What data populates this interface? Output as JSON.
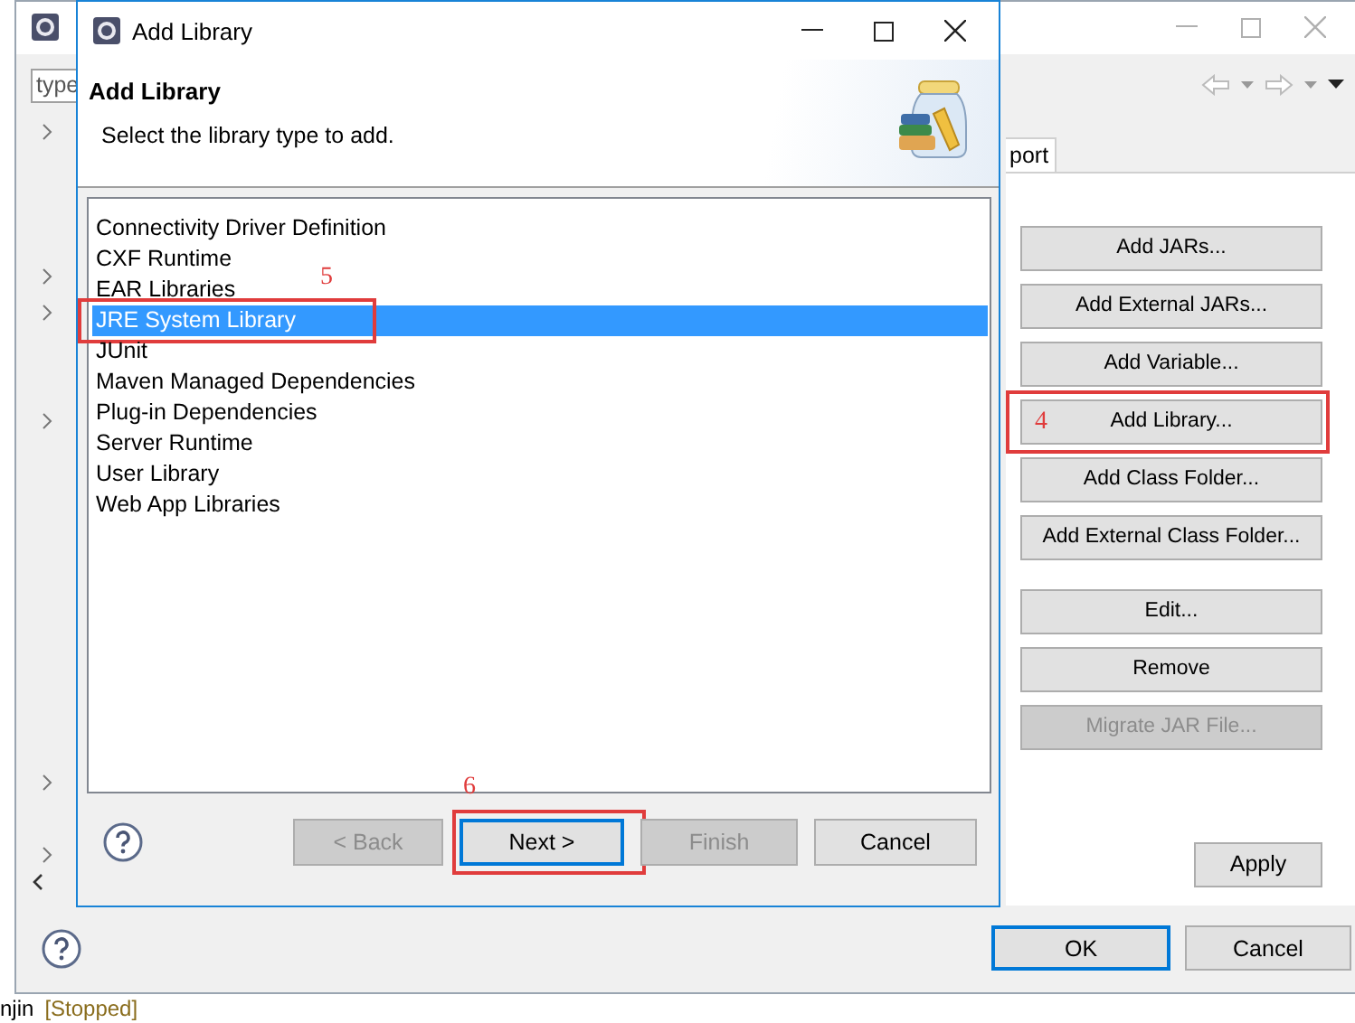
{
  "back_window": {
    "filter": {
      "value": "type"
    },
    "tree_rows": [
      {
        "expandable": true
      },
      {
        "expandable": false
      },
      {
        "expandable": false
      },
      {
        "expandable": false
      },
      {
        "expandable": true
      },
      {
        "expandable": true
      },
      {
        "expandable": false
      },
      {
        "expandable": false
      },
      {
        "expandable": true
      },
      {
        "expandable": false
      },
      {
        "expandable": false
      },
      {
        "expandable": false
      },
      {
        "expandable": false
      },
      {
        "expandable": false
      },
      {
        "expandable": false
      },
      {
        "expandable": false
      },
      {
        "expandable": false
      },
      {
        "expandable": false
      },
      {
        "expandable": true
      },
      {
        "expandable": false
      },
      {
        "expandable": true
      }
    ],
    "tab": {
      "label": "port"
    },
    "side_button_groups": [
      {
        "buttons": [
          {
            "label": "Add JARs...",
            "disabled": false
          },
          {
            "label": "Add External JARs...",
            "disabled": false
          },
          {
            "label": "Add Variable...",
            "disabled": false
          },
          {
            "label": "Add Library...",
            "disabled": false,
            "annotation": "4"
          },
          {
            "label": "Add Class Folder...",
            "disabled": false
          },
          {
            "label": "Add External Class Folder...",
            "disabled": false
          }
        ]
      },
      {
        "buttons": [
          {
            "label": "Edit...",
            "disabled": false
          },
          {
            "label": "Remove",
            "disabled": false
          },
          {
            "label": "Migrate JAR File...",
            "disabled": true
          }
        ]
      }
    ],
    "apply": "Apply",
    "footer_buttons": [
      {
        "label": "OK",
        "default": true
      },
      {
        "label": "Cancel",
        "default": false
      }
    ],
    "console": {
      "name": "njin",
      "state": "[Stopped]"
    }
  },
  "dialog": {
    "title": "Add Library",
    "heading": "Add Library",
    "description": "Select the library type to add.",
    "libraries": [
      {
        "label": "Connectivity Driver Definition",
        "selected": false
      },
      {
        "label": "CXF Runtime",
        "selected": false
      },
      {
        "label": "EAR Libraries",
        "selected": false
      },
      {
        "label": "JRE System Library",
        "selected": true,
        "annotation": "5"
      },
      {
        "label": "JUnit",
        "selected": false
      },
      {
        "label": "Maven Managed Dependencies",
        "selected": false
      },
      {
        "label": "Plug-in Dependencies",
        "selected": false
      },
      {
        "label": "Server Runtime",
        "selected": false
      },
      {
        "label": "User Library",
        "selected": false
      },
      {
        "label": "Web App Libraries",
        "selected": false
      }
    ],
    "buttons": [
      {
        "label": "< Back",
        "disabled": true,
        "default": false
      },
      {
        "label": "Next >",
        "disabled": false,
        "default": true,
        "annotation": "6"
      },
      {
        "label": "Finish",
        "disabled": true,
        "default": false
      },
      {
        "label": "Cancel",
        "disabled": false,
        "default": false
      }
    ]
  }
}
